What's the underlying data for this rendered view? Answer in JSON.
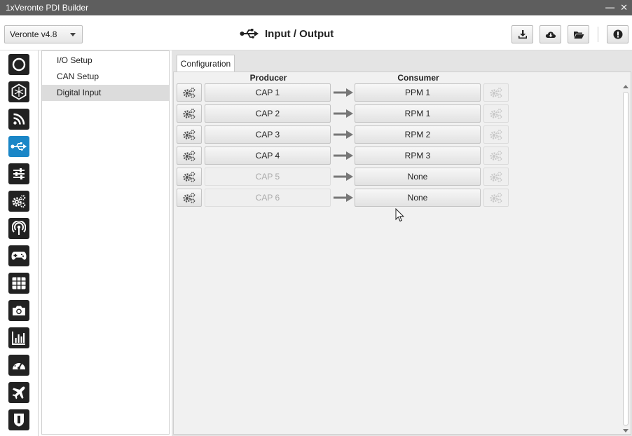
{
  "window": {
    "title": "1xVeronte PDI Builder",
    "controls": [
      "minimize-icon",
      "close-icon"
    ]
  },
  "toolbar": {
    "version_select": "Veronte v4.8",
    "page_title": "Input / Output",
    "page_icon": "usb-icon",
    "buttons": [
      {
        "name": "download-button",
        "icon": "download-tray-icon"
      },
      {
        "name": "cloud-download-button",
        "icon": "cloud-download-icon"
      },
      {
        "name": "open-folder-button",
        "icon": "folder-open-icon"
      },
      {
        "name": "info-button",
        "icon": "exclamation-icon"
      }
    ]
  },
  "sidebar": {
    "items": [
      {
        "icon": "ring-icon"
      },
      {
        "icon": "hexagon-icon"
      },
      {
        "icon": "rss-icon"
      },
      {
        "icon": "usb-icon",
        "active": true
      },
      {
        "icon": "sliders-icon"
      },
      {
        "icon": "gears-icon"
      },
      {
        "icon": "broadcast-icon"
      },
      {
        "icon": "gamepad-icon"
      },
      {
        "icon": "grid-icon"
      },
      {
        "icon": "camera-icon"
      },
      {
        "icon": "bar-chart-icon"
      },
      {
        "icon": "gauge-icon"
      },
      {
        "icon": "airplane-icon"
      },
      {
        "icon": "shield-icon"
      }
    ]
  },
  "nav": {
    "items": [
      {
        "label": "I/O Setup"
      },
      {
        "label": "CAN Setup"
      },
      {
        "label": "Digital Input",
        "selected": true
      }
    ]
  },
  "main": {
    "tab": "Configuration",
    "producer_header": "Producer",
    "consumer_header": "Consumer",
    "rows": [
      {
        "producer": "CAP 1",
        "consumer": "PPM 1",
        "producer_enabled": true
      },
      {
        "producer": "CAP 2",
        "consumer": "RPM 1",
        "producer_enabled": true
      },
      {
        "producer": "CAP 3",
        "consumer": "RPM 2",
        "producer_enabled": true
      },
      {
        "producer": "CAP 4",
        "consumer": "RPM 3",
        "producer_enabled": true
      },
      {
        "producer": "CAP 5",
        "consumer": "None",
        "producer_enabled": false
      },
      {
        "producer": "CAP 6",
        "consumer": "None",
        "producer_enabled": false
      }
    ]
  },
  "colors": {
    "titlebar": "#5e5e5e",
    "accent": "#1a86c7",
    "sidebar_icon_bg": "#222222",
    "content_bg": "#e4e4e4"
  }
}
